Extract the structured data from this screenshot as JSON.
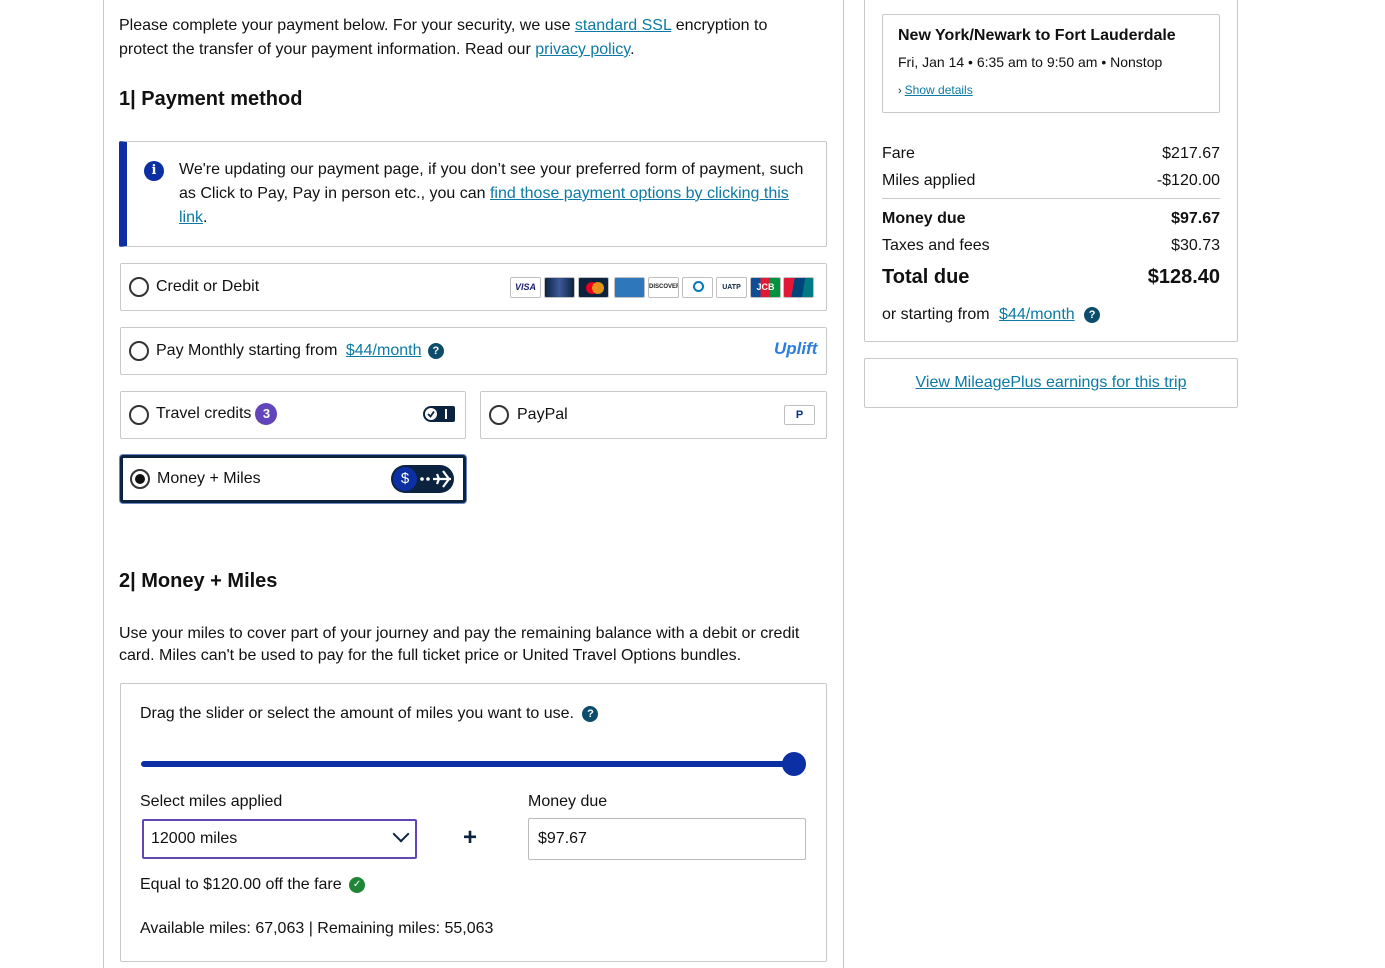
{
  "intro": {
    "text_before": "Please complete your payment below. For your security, we use ",
    "ssl_link": "standard SSL",
    "text_middle": " encryption to protect the transfer of your payment information. Read our ",
    "privacy_link": "privacy policy",
    "text_end": "."
  },
  "section1": {
    "title": "1| Payment method"
  },
  "info_notice": {
    "text": "We're updating our payment page, if you don’t see your preferred form of payment, such as Click to Pay, Pay in person etc., you can ",
    "link": "find those payment options by clicking this link",
    "end": "."
  },
  "payment_options": {
    "credit": {
      "label": "Credit or Debit",
      "selected": false
    },
    "monthly": {
      "label": "Pay Monthly starting from",
      "link": "$44/month",
      "brand": "Uplift",
      "selected": false
    },
    "travel_credits": {
      "label": "Travel credits",
      "count": "3",
      "selected": false
    },
    "paypal": {
      "label": "PayPal",
      "selected": false
    },
    "money_miles": {
      "label": "Money + Miles",
      "selected": true
    }
  },
  "card_brands": [
    "VISA",
    "United",
    "MasterCard",
    "AmEx",
    "DISCOVER",
    "Diners Club",
    "UATP",
    "JCB",
    "UnionPay"
  ],
  "section2": {
    "title": "2| Money + Miles",
    "description": "Use your miles to cover part of your journey and pay the remaining balance with a debit or credit card. Miles can't be used to pay for the full ticket price or United Travel Options bundles."
  },
  "slider": {
    "instruction": "Drag the slider or select the amount of miles you want to use.",
    "level": 1.0,
    "miles_label": "Select miles applied",
    "miles_value": "12000 miles",
    "money_label": "Money due",
    "money_value": "$97.67",
    "equal_text": "Equal to $120.00 off the fare",
    "balance_text": "Available miles: 67,063 | Remaining miles: 55,063"
  },
  "trip": {
    "route": "New York/Newark to Fort Lauderdale",
    "details": "Fri, Jan 14 • 6:35 am to 9:50 am • Nonstop",
    "show_details": "Show details"
  },
  "summary": {
    "fare_label": "Fare",
    "fare_value": "$217.67",
    "miles_label": "Miles applied",
    "miles_value": "-$120.00",
    "money_label": "Money due",
    "money_value": "$97.67",
    "taxes_label": "Taxes and fees",
    "taxes_value": "$30.73",
    "total_label": "Total due",
    "total_value": "$128.40",
    "starting_label": "or starting from",
    "starting_link": "$44/month"
  },
  "earnings_link": "View MileagePlus earnings for this trip",
  "colors": {
    "accent": "#0c2fa3",
    "link": "#0c7aa4",
    "badge": "#6244bb",
    "check": "#208637"
  }
}
